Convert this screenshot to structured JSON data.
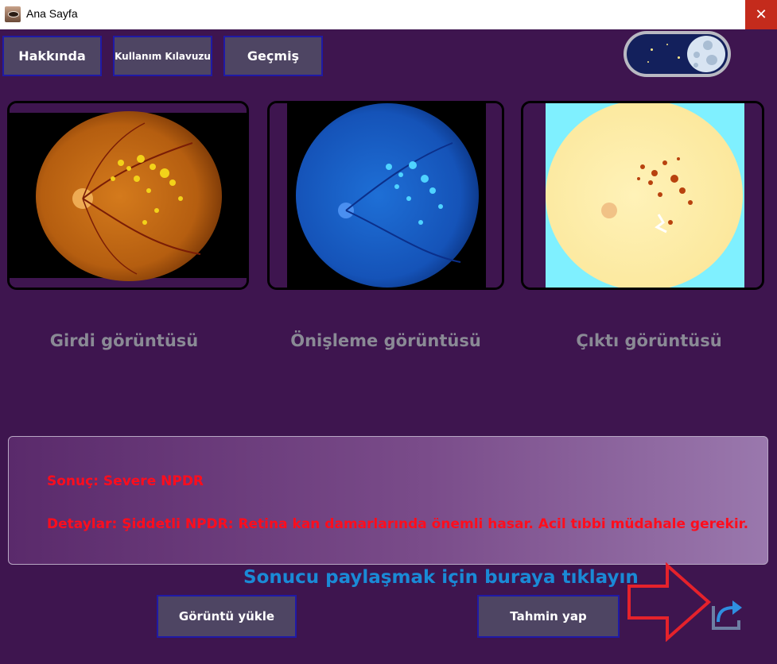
{
  "window": {
    "title": "Ana Sayfa",
    "close_symbol": "✕"
  },
  "toolbar": {
    "about_label": "Hakkında",
    "guide_label": "Kullanım Kılavuzu",
    "history_label": "Geçmiş"
  },
  "theme_toggle": {
    "mode": "dark",
    "icon": "moon-icon"
  },
  "images": {
    "input_label": "Girdi görüntüsü",
    "preprocess_label": "Önişleme görüntüsü",
    "output_label": "Çıktı görüntüsü"
  },
  "result": {
    "conclusion": "Sonuç: Severe NPDR",
    "details": "Detaylar: Şiddetli NPDR: Retina kan damarlarında önemli hasar. Acil tıbbi müdahale gerekir."
  },
  "share": {
    "text": "Sonucu paylaşmak için buraya tıklayın",
    "icon": "share-icon"
  },
  "actions": {
    "upload_label": "Görüntü yükle",
    "predict_label": "Tahmin yap"
  },
  "colors": {
    "background": "#3e154f",
    "button": "#4e4563",
    "button_border": "#1f1aa6",
    "result_text": "#ff0d1d",
    "share_text": "#1a8ad6",
    "arrow": "#e5222b"
  }
}
